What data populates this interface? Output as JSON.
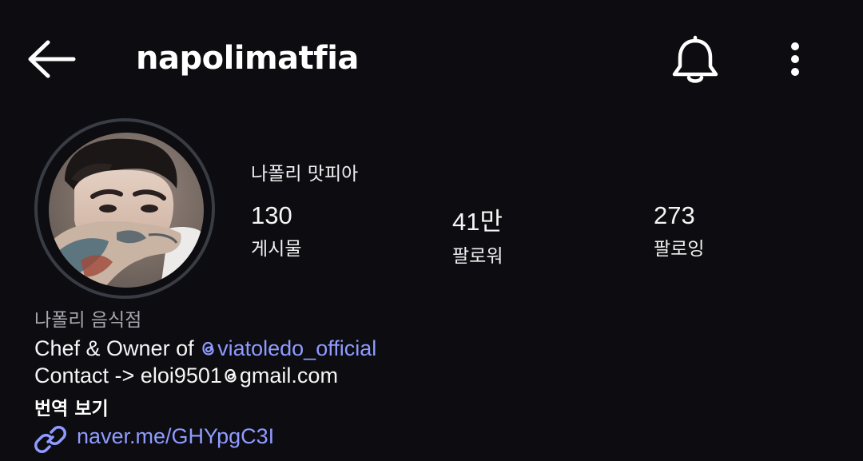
{
  "header": {
    "username": "napolimatfia",
    "back_icon": "arrow-left-icon",
    "notifications_icon": "bell-icon",
    "more_icon": "more-vertical-icon"
  },
  "profile": {
    "display_name": "나폴리 맛피아",
    "stats": [
      {
        "count": "130",
        "label": "게시물"
      },
      {
        "count": "41만",
        "label": "팔로워"
      },
      {
        "count": "273",
        "label": "팔로잉"
      }
    ],
    "category": "나폴리 음식점",
    "bio": {
      "line1_prefix": "Chef & Owner of ",
      "line1_mention": "viatoledo_official",
      "line2_prefix": "Contact -> eloi9501",
      "line2_suffix": "gmail.com",
      "mention_icon": "threads-icon"
    },
    "translate_label": "번역 보기",
    "link": {
      "icon": "link-icon",
      "text": "naver.me/GHYpgC3I"
    }
  },
  "colors": {
    "background": "#0c0c11",
    "text": "#f5f5f5",
    "secondary_text": "#a8a8ae",
    "link": "#8f9bff",
    "avatar_ring": "#3a3c44"
  }
}
